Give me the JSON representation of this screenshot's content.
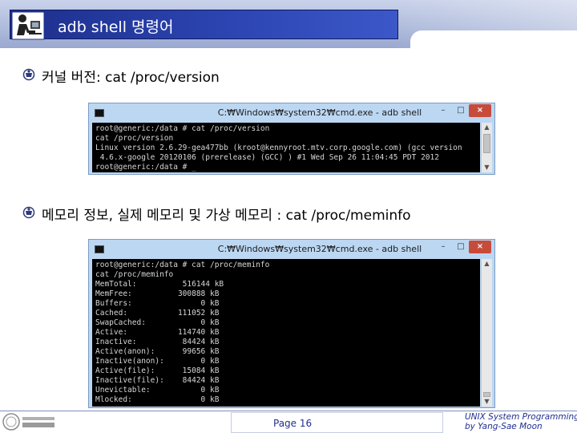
{
  "header": {
    "title": "adb shell 명령어"
  },
  "bullets": [
    {
      "text": "커널 버전: cat /proc/version"
    },
    {
      "text": "메모리 정보, 실제 메모리 및 가상 메모리 : cat /proc/meminfo"
    }
  ],
  "cmd_windows": [
    {
      "title": "C:₩Windows₩system32₩cmd.exe - adb  shell",
      "min_label": "–",
      "max_label": "□",
      "close_label": "×",
      "lines": [
        "root@generic:/data # cat /proc/version",
        "cat /proc/version",
        "Linux version 2.6.29-gea477bb (kroot@kennyroot.mtv.corp.google.com) (gcc version",
        " 4.6.x-google 20120106 (prerelease) (GCC) ) #1 Wed Sep 26 11:04:45 PDT 2012",
        "root@generic:/data # _"
      ]
    },
    {
      "title": "C:₩Windows₩system32₩cmd.exe - adb  shell",
      "min_label": "–",
      "max_label": "□",
      "close_label": "×",
      "lines": [
        "root@generic:/data # cat /proc/meminfo",
        "cat /proc/meminfo",
        "MemTotal:          516144 kB",
        "MemFree:          300888 kB",
        "Buffers:               0 kB",
        "Cached:           111052 kB",
        "SwapCached:            0 kB",
        "Active:           114740 kB",
        "Inactive:          84424 kB",
        "Active(anon):      99656 kB",
        "Inactive(anon):        0 kB",
        "Active(file):      15084 kB",
        "Inactive(file):    84424 kB",
        "Unevictable:           0 kB",
        "Mlocked:               0 kB"
      ]
    }
  ],
  "footer": {
    "page": "Page 16",
    "course": "UNIX System Programming",
    "author": "by Yang-Sae Moon"
  },
  "colors": {
    "title_bar": "#2d46b4",
    "header_band": "#aebadb",
    "console_bg": "#000000",
    "console_text": "#d6d6d6",
    "window_frame": "#bcd7f2",
    "close_button": "#c74b3a",
    "footer_text": "#1f2f8f"
  },
  "icons": {
    "title": "person-at-computer-icon",
    "bullet": "bullet-emblem-icon",
    "cmd": "cmd-prompt-icon",
    "logo": "university-logo-icon"
  }
}
